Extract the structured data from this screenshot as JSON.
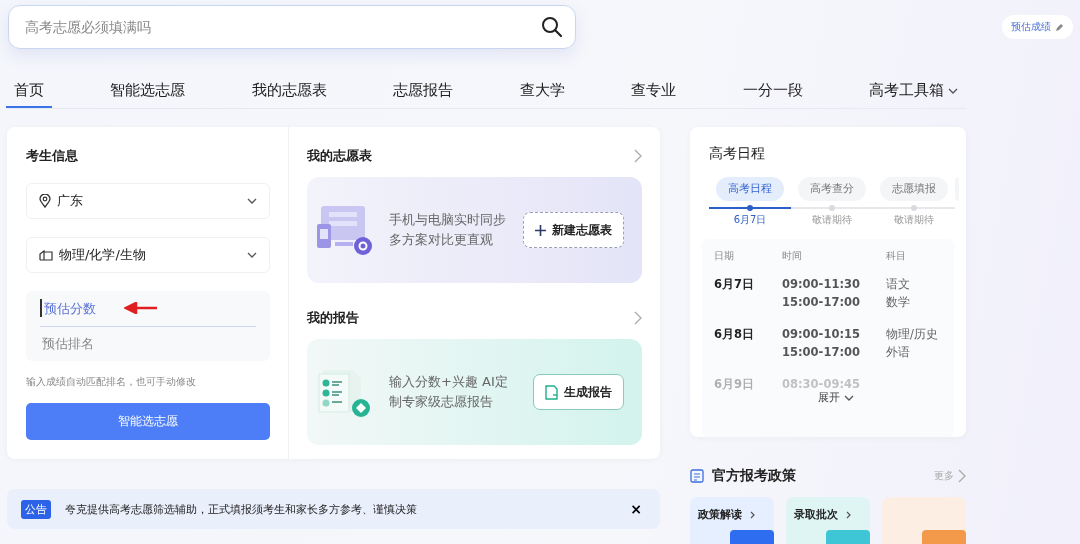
{
  "search": {
    "placeholder": "高考志愿必须填满吗"
  },
  "score_button": {
    "label": "预估成绩"
  },
  "nav": [
    {
      "label": "首页",
      "selected": true,
      "dropdown": false
    },
    {
      "label": "智能选志愿",
      "selected": false,
      "dropdown": false
    },
    {
      "label": "我的志愿表",
      "selected": false,
      "dropdown": false
    },
    {
      "label": "志愿报告",
      "selected": false,
      "dropdown": false
    },
    {
      "label": "查大学",
      "selected": false,
      "dropdown": false
    },
    {
      "label": "查专业",
      "selected": false,
      "dropdown": false
    },
    {
      "label": "一分一段",
      "selected": false,
      "dropdown": false
    },
    {
      "label": "高考工具箱",
      "selected": false,
      "dropdown": true
    }
  ],
  "student_info": {
    "title": "考生信息",
    "province": "广东",
    "subjects": "物理/化学/生物",
    "score_field": {
      "placeholder": "预估分数",
      "focused": true
    },
    "rank_field": {
      "placeholder": "预估排名"
    },
    "hint": "输入成绩自动匹配排名，也可手动修改",
    "submit": "智能选志愿"
  },
  "my_list": {
    "title": "我的志愿表",
    "lines": [
      "手机与电脑实时同步",
      "多方案对比更直观"
    ],
    "button": "新建志愿表"
  },
  "my_report": {
    "title": "我的报告",
    "lines": [
      "输入分数+兴趣 AI定",
      "制专家级志愿报告"
    ],
    "button": "生成报告"
  },
  "schedule": {
    "title": "高考日程",
    "stages": [
      {
        "label": "高考日程",
        "date": "6月7日",
        "selected": true
      },
      {
        "label": "高考查分",
        "date": "敬请期待",
        "selected": false
      },
      {
        "label": "志愿填报",
        "date": "敬请期待",
        "selected": false
      }
    ],
    "columns": [
      "日期",
      "时间",
      "科目"
    ],
    "rows": [
      {
        "date": "6月7日",
        "times": [
          "09:00-11:30",
          "15:00-17:00"
        ],
        "subjects": [
          "语文",
          "数学"
        ],
        "faded": false
      },
      {
        "date": "6月8日",
        "times": [
          "09:00-10:15",
          "15:00-17:00"
        ],
        "subjects": [
          "物理/历史",
          "外语"
        ],
        "faded": false
      },
      {
        "date": "6月9日",
        "times": [
          "08:30-09:45"
        ],
        "subjects": [],
        "faded": true
      }
    ],
    "expand": "展开"
  },
  "notice": {
    "badge": "公告",
    "text": "夸克提供高考志愿筛选辅助，正式填报须考生和家长多方参考、谨慎决策",
    "close": "×"
  },
  "policy": {
    "title": "官方报考政策",
    "more": "更多",
    "cards": [
      {
        "label": "政策解读",
        "kind": "blue"
      },
      {
        "label": "录取批次",
        "kind": "teal"
      },
      {
        "kind": "orange"
      }
    ]
  }
}
